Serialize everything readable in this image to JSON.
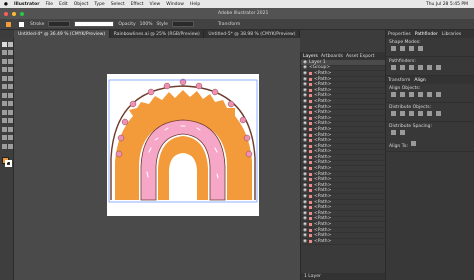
{
  "menubar": {
    "app": "Illustrator",
    "items": [
      "File",
      "Edit",
      "Object",
      "Type",
      "Select",
      "Effect",
      "View",
      "Window",
      "Help"
    ],
    "clock": "Thu Jul 28 5:45 PM"
  },
  "title": "Adobe Illustrator 2021",
  "control": {
    "label1": "Stroke",
    "opacity_label": "Opacity",
    "opacity": "100%",
    "style_label": "Style",
    "transform_label": "Transform"
  },
  "tabs": [
    {
      "label": "Untitled-4* @ 36.49 % (CMYK/Preview)",
      "active": true
    },
    {
      "label": "Rainbowlines.ai @ 25% (RGB/Preview)",
      "active": false
    },
    {
      "label": "Untitled-5* @ 38.98 % (CMYK/Preview)",
      "active": false
    }
  ],
  "layers_panel": {
    "tabs": [
      "Layers",
      "Artboards",
      "Asset Export"
    ],
    "layer_name": "Layer 1",
    "group_name": "<Group>",
    "item_label": "<Path>",
    "footer": "1 Layer"
  },
  "properties_panel": {
    "tabs": [
      "Properties",
      "Pathfinder",
      "Libraries"
    ],
    "shape_modes": "Shape Modes:",
    "pathfinders": "Pathfinders:",
    "tabs2": [
      "Transform",
      "Align"
    ],
    "align_objects": "Align Objects:",
    "distribute_objects": "Distribute Objects:",
    "distribute_spacing": "Distribute Spacing:",
    "align_to": "Align To:"
  },
  "colors": {
    "orange": "#f39a3a",
    "pink": "#f6a7c7",
    "brown": "#6d3b2c",
    "dot": "#f08fb4"
  }
}
